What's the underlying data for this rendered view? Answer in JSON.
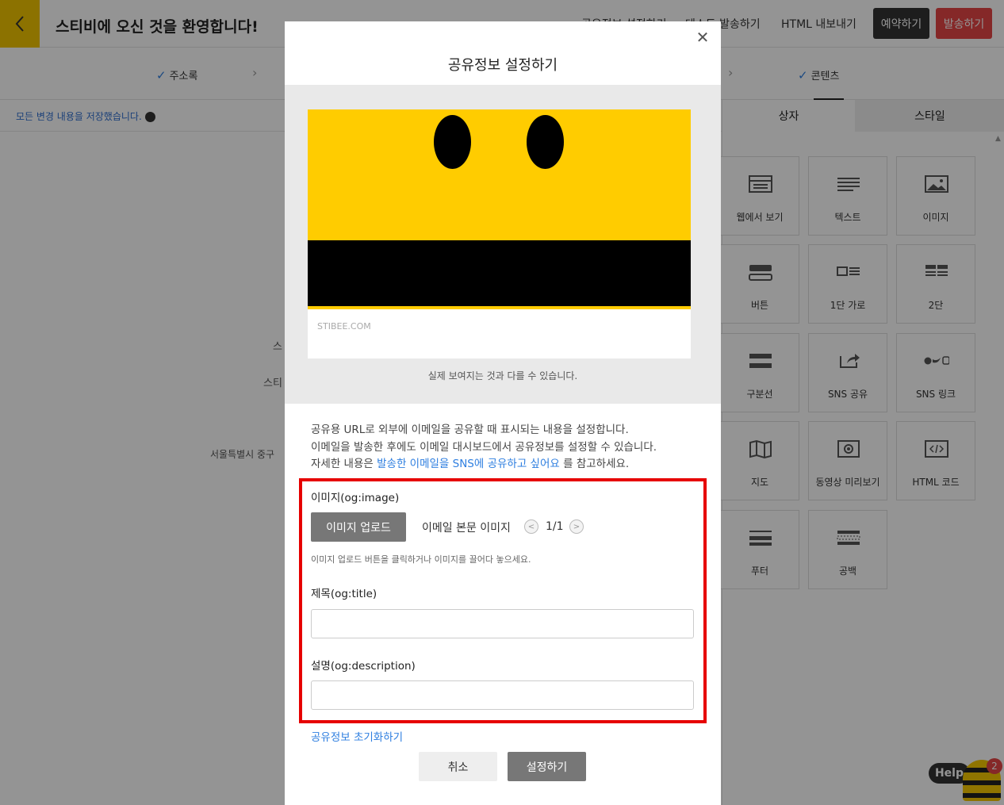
{
  "app": {
    "title": "스티비에 오신 것을 환영합니다!",
    "top_links": [
      "공유정보 설정하기",
      "테스트 발송하기",
      "HTML 내보내기"
    ],
    "reserve_label": "예약하기",
    "send_label": "발송하기"
  },
  "steps": [
    {
      "label": "주소록"
    },
    {
      "label": "콘텐츠"
    }
  ],
  "save_status": "모든 변경 내용을 저장했습니다.",
  "background_text": {
    "partial1": "스",
    "partial2": "스티",
    "address": "서울특별시 중구"
  },
  "panel": {
    "tabs": [
      "상자",
      "스타일"
    ],
    "tiles": [
      {
        "label": "웹에서 보기",
        "icon": "web-view-icon"
      },
      {
        "label": "텍스트",
        "icon": "text-icon"
      },
      {
        "label": "이미지",
        "icon": "image-icon"
      },
      {
        "label": "버튼",
        "icon": "button-icon"
      },
      {
        "label": "1단 가로",
        "icon": "one-column-horizontal-icon"
      },
      {
        "label": "2단",
        "icon": "two-column-icon"
      },
      {
        "label": "구분선",
        "icon": "divider-icon"
      },
      {
        "label": "SNS 공유",
        "icon": "share-icon"
      },
      {
        "label": "SNS 링크",
        "icon": "sns-link-icon"
      },
      {
        "label": "지도",
        "icon": "map-icon"
      },
      {
        "label": "동영상 미리보기",
        "icon": "video-icon"
      },
      {
        "label": "HTML 코드",
        "icon": "code-icon"
      },
      {
        "label": "푸터",
        "icon": "footer-icon"
      },
      {
        "label": "공백",
        "icon": "spacer-icon"
      }
    ]
  },
  "help": {
    "label": "Help",
    "badge": "2"
  },
  "modal": {
    "title": "공유정보 설정하기",
    "preview_domain": "STIBEE.COM",
    "preview_note": "실제 보여지는 것과 다를 수 있습니다.",
    "desc_line1": "공유용 URL로 외부에 이메일을 공유할 때 표시되는 내용을 설정합니다.",
    "desc_line2": "이메일을 발송한 후에도 이메일 대시보드에서 공유정보를 설정할 수 있습니다.",
    "desc_line3_prefix": "자세한 내용은",
    "desc_line3_link": "발송한 이메일을 SNS에 공유하고 싶어요",
    "desc_line3_suffix": "를 참고하세요.",
    "image_label": "이미지(og:image)",
    "upload_label": "이미지 업로드",
    "body_image_label": "이메일 본문 이미지",
    "pager": "1/1",
    "hint": "이미지 업로드 버튼을 클릭하거나 이미지를 끌어다 놓으세요.",
    "title_label": "제목(og:title)",
    "title_value": "",
    "description_label": "설명(og:description)",
    "description_value": "",
    "reset_label": "공유정보 초기화하기",
    "cancel_label": "취소",
    "confirm_label": "설정하기"
  },
  "colors": {
    "brand_yellow": "#ffcc00",
    "send_red": "#e64545",
    "link_blue": "#2f7fe0",
    "highlight_red": "#e60000"
  }
}
